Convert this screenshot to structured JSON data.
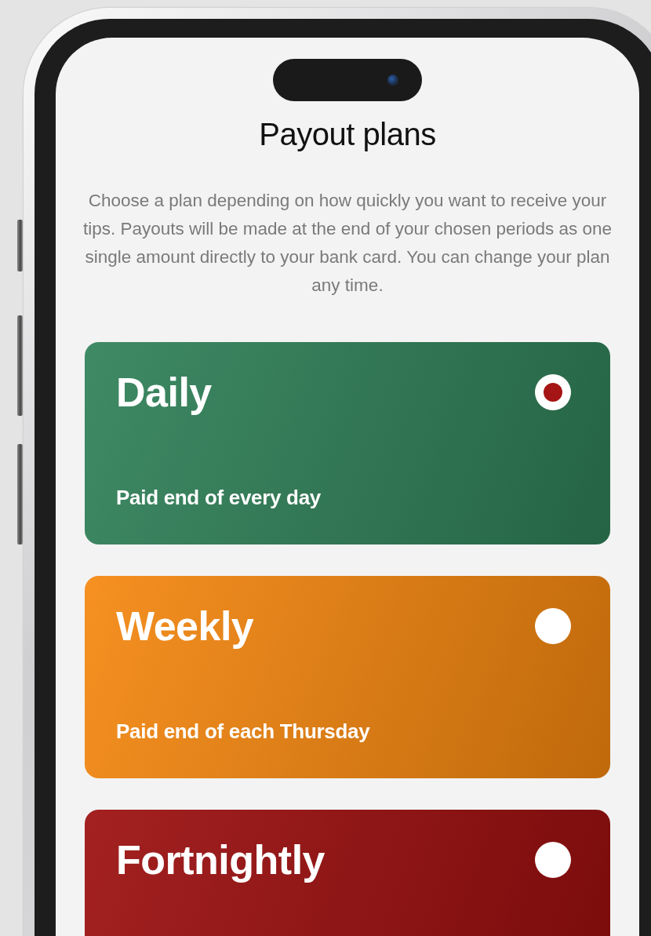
{
  "title": "Payout plans",
  "description": "Choose a plan depending on how quickly you want to receive your tips. Payouts will be made at the end of your chosen periods as one single amount directly to your bank card. You can change your plan any time.",
  "plans": [
    {
      "name": "Daily",
      "subtitle": "Paid end of every day",
      "color": "#2f8058",
      "selected": true
    },
    {
      "name": "Weekly",
      "subtitle": "Paid end of each Thursday",
      "color": "#f5870f",
      "selected": false
    },
    {
      "name": "Fortnightly",
      "color": "#9c0e0e",
      "selected": false
    }
  ]
}
